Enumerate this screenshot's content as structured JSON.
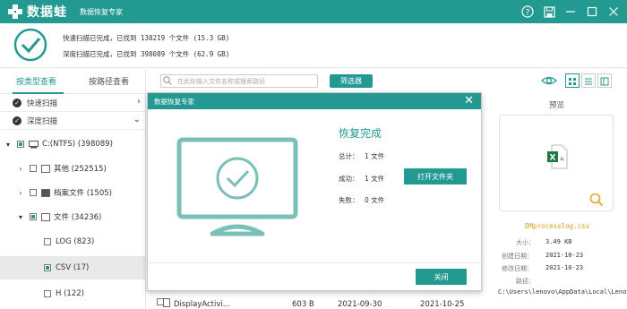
{
  "app": {
    "name": "数据蛙",
    "subtitle": "数据恢复专家"
  },
  "summary": {
    "quick_line": "快速扫描已完成，已找到 138219 个文件 (15.3 GB)",
    "deep_line": "深度扫描已完成，已找到 398089 个文件 (62.9 GB)"
  },
  "sidebar": {
    "tabs": [
      "按类型查看",
      "按路径查看"
    ],
    "scans": [
      "快速扫描",
      "深度扫描"
    ],
    "tree": [
      {
        "label": "C:(NTFS) (398089)"
      },
      {
        "label": "其他 (252515)"
      },
      {
        "label": "档案文件 (1505)"
      },
      {
        "label": "文件 (34236)"
      },
      {
        "label": "LOG (823)"
      },
      {
        "label": "CSV (17)"
      },
      {
        "label": "H (122)"
      }
    ]
  },
  "toolbar": {
    "search_placeholder": "在此处输入文件名称或搜索路径",
    "filter_label": "筛选器"
  },
  "preview": {
    "title": "预览",
    "file_name": "DMprocesslog.csv",
    "size_label": "大小：",
    "size_value": "3.49 KB",
    "created_label": "创建日期：",
    "created_value": "2021-10-23",
    "modified_label": "修改日期：",
    "modified_value": "2021-10-23",
    "path_label": "路径：",
    "path_value": "C:\\Users\\lenovo\\AppData\\Local\\Lenovo\\ImController\\PluginData"
  },
  "file_row": {
    "name": "DisplayActivi...",
    "size": "603 B",
    "created": "2021-09-30",
    "modified": "2021-10-25"
  },
  "modal": {
    "header": "数据恢复专家",
    "title": "恢复完成",
    "total_label": "总计：",
    "total_value": "1 文件",
    "success_label": "成功：",
    "success_value": "1 文件",
    "fail_label": "失败：",
    "fail_value": "0 文件",
    "open_folder": "打开文件夹",
    "close": "关闭"
  },
  "colors": {
    "accent": "#229a91",
    "preview_name": "#d9a21b"
  }
}
